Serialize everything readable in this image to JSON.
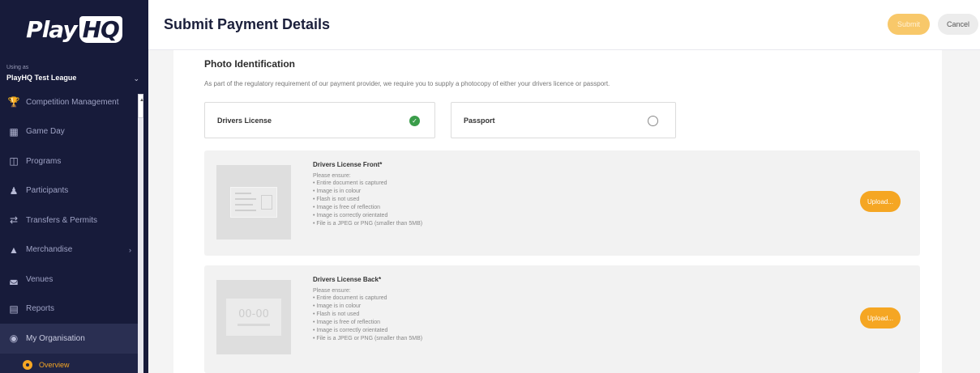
{
  "app": {
    "logo_play": "Play",
    "logo_hq": "HQ"
  },
  "sidebar": {
    "using_as": "Using as",
    "organisation": "PlayHQ Test League",
    "items": [
      {
        "label": "Competition Management",
        "icon": "trophy-icon"
      },
      {
        "label": "Game Day",
        "icon": "scoreboard-icon"
      },
      {
        "label": "Programs",
        "icon": "book-icon"
      },
      {
        "label": "Participants",
        "icon": "people-icon"
      },
      {
        "label": "Transfers & Permits",
        "icon": "transfer-icon"
      },
      {
        "label": "Merchandise",
        "icon": "shirt-icon"
      },
      {
        "label": "Venues",
        "icon": "stadium-icon"
      },
      {
        "label": "Reports",
        "icon": "chart-icon"
      },
      {
        "label": "My Organisation",
        "icon": "organisation-icon"
      }
    ],
    "sub_items": [
      {
        "label": "Overview"
      }
    ]
  },
  "header": {
    "title": "Submit Payment Details",
    "submit_label": "Submit",
    "cancel_label": "Cancel"
  },
  "photo_id": {
    "title": "Photo Identification",
    "description": "As part of the regulatory requirement of our payment provider, we require you to supply a photocopy of either your drivers licence or passport.",
    "options": [
      {
        "label": "Drivers License",
        "selected": true
      },
      {
        "label": "Passport",
        "selected": false
      }
    ],
    "uploads": [
      {
        "title": "Drivers License Front*",
        "ensure": "Please ensure:",
        "requirements": [
          "Entire document is captured",
          "Image is in colour",
          "Flash is not used",
          "Image is free of reflection",
          "Image is correctly orientated",
          "File is a JPEG or PNG (smaller than 5MB)"
        ],
        "button": "Upload..."
      },
      {
        "title": "Drivers License Back*",
        "ensure": "Please ensure:",
        "requirements": [
          "Entire document is captured",
          "Image is in colour",
          "Flash is not used",
          "Image is free of reflection",
          "Image is correctly orientated",
          "File is a JPEG or PNG (smaller than 5MB)"
        ],
        "button": "Upload...",
        "placeholder_text": "00-00"
      }
    ]
  },
  "colors": {
    "sidebar": "#171b3a",
    "accent": "#f5a623",
    "check": "#3a9d4a"
  }
}
